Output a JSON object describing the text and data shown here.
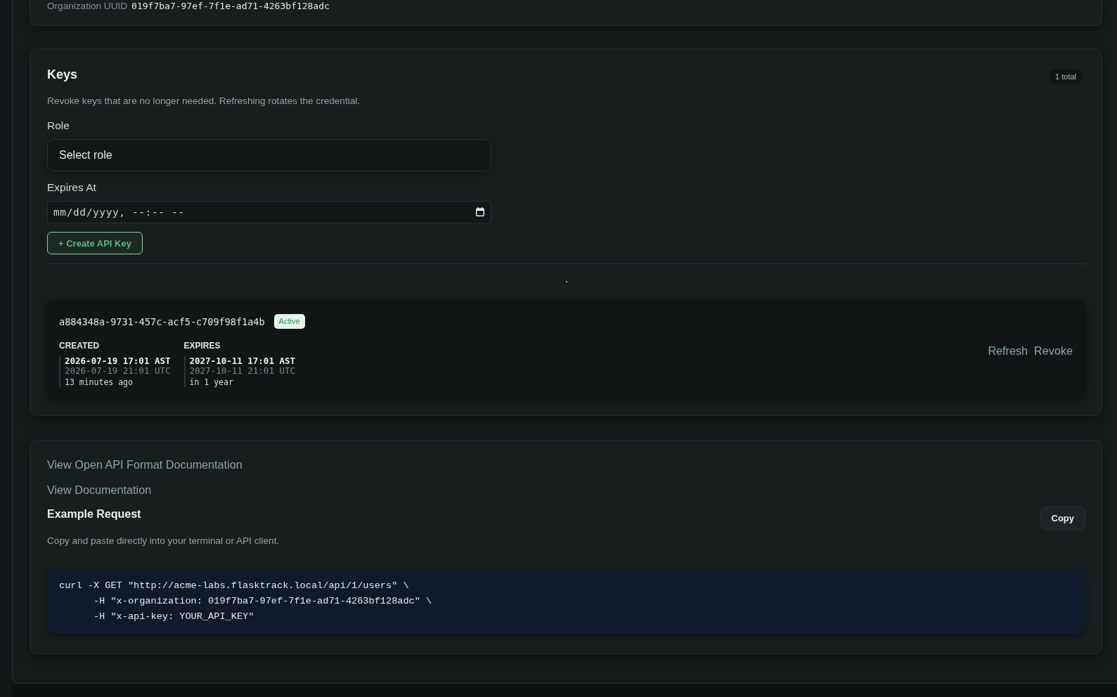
{
  "organization_card": {
    "label": "Organization UUID",
    "value": "019f7ba7-97ef-7f1e-ad71-4263bf128adc"
  },
  "keys_card": {
    "title": "Keys",
    "count_badge": "1 total",
    "description": "Revoke keys that are no longer needed. Refreshing rotates the credential.",
    "role_field": {
      "label": "Role",
      "placeholder": "Select role"
    },
    "expires_field": {
      "label": "Expires At",
      "placeholder": "mm/dd/yyyy, --:-- --"
    },
    "create_button": "+ Create API Key",
    "keys": [
      {
        "key_id": "a884348a-9731-457c-acf5-c709f98f1a4b",
        "status": "Active",
        "dates": [
          {
            "label": "CREATED",
            "local": "2026-07-19 17:01 AST",
            "utc": "2026-07-19 21:01 UTC",
            "relative": "13 minutes ago"
          },
          {
            "label": "EXPIRES",
            "local": "2027-10-11 17:01 AST",
            "utc": "2027-10-11 21:01 UTC",
            "relative": "in 1 year"
          }
        ],
        "actions": [
          "Refresh",
          "Revoke"
        ]
      }
    ]
  },
  "docs_card": {
    "links": [
      "View Open API Format Documentation",
      "View Documentation"
    ],
    "example_title": "Example Request",
    "copy_button": "Copy",
    "example_description": "Copy and paste directly into your terminal or API client.",
    "code_lines": [
      "curl -X GET \"http://acme-labs.flasktrack.local/api/1/users\" \\",
      "      -H \"x-organization: 019f7ba7-97ef-7f1e-ad71-4263bf128adc\" \\",
      "      -H \"x-api-key: YOUR_API_KEY\""
    ]
  }
}
